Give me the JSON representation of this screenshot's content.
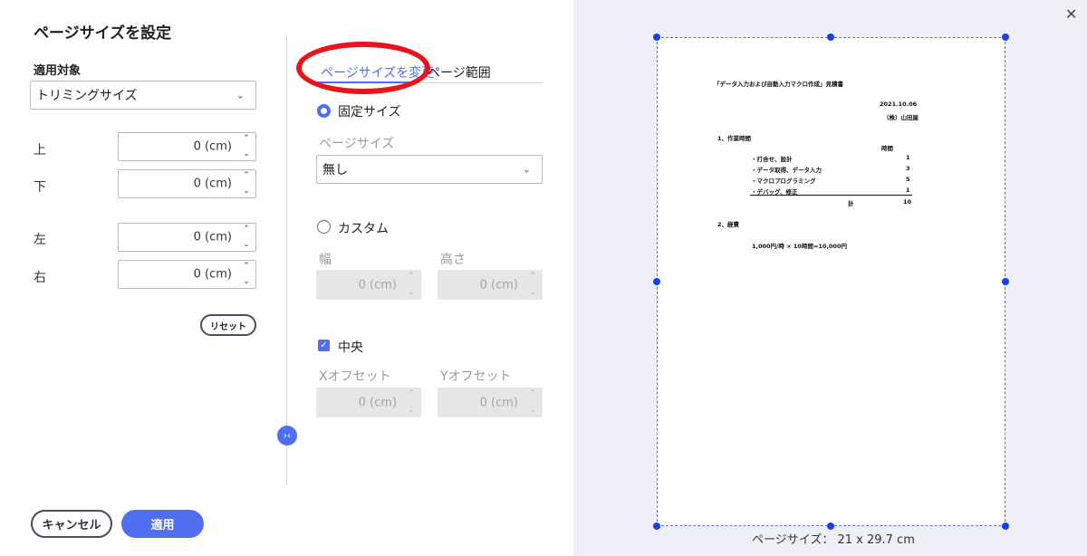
{
  "dialog": {
    "title": "ページサイズを設定",
    "apply_target_label": "適用対象",
    "apply_target_value": "トリミングサイズ",
    "margins": [
      {
        "label": "上",
        "value": "0 (cm)"
      },
      {
        "label": "下",
        "value": "0 (cm)"
      },
      {
        "label": "左",
        "value": "0 (cm)"
      },
      {
        "label": "右",
        "value": "0 (cm)"
      }
    ],
    "reset_label": "リセット",
    "cancel_label": "キャンセル",
    "apply_label": "適用"
  },
  "tabs": [
    {
      "label": "ページサイズを変更",
      "active": true
    },
    {
      "label": "ページ範囲",
      "active": false
    }
  ],
  "page_size_panel": {
    "fixed_label": "固定サイズ",
    "page_size_label": "ページサイズ",
    "page_size_value": "無し",
    "custom_label": "カスタム",
    "width_label": "幅",
    "height_label": "高さ",
    "width_value": "0 (cm)",
    "height_value": "0 (cm)",
    "center_label": "中央",
    "x_offset_label": "Xオフセット",
    "y_offset_label": "Yオフセット",
    "x_offset_value": "0 (cm)",
    "y_offset_value": "0 (cm)"
  },
  "preview": {
    "page_size_text": "ページサイズ： 21 x 29.7 cm",
    "doc": {
      "title": "「データ入力および自動入力マクロ作成」見積書",
      "date": "2021.10.06",
      "company": "（株）山田屋",
      "section1": "1、作業時間",
      "hours_header": "時間",
      "rows": [
        {
          "item": "・打合せ、設計",
          "hours": "1"
        },
        {
          "item": "・データ取得、データ入力",
          "hours": "3"
        },
        {
          "item": "・マクロプログラミング",
          "hours": "5"
        },
        {
          "item": "・デバッグ、修正",
          "hours": "1"
        }
      ],
      "total_label": "計",
      "total_value": "10",
      "section2": "2、経費",
      "expense": "1,000円/時 × 10時間=10,000円"
    }
  },
  "colors": {
    "accent": "#4f6ef0",
    "annotation": "#e8141b",
    "preview_bg": "#efeff7"
  }
}
